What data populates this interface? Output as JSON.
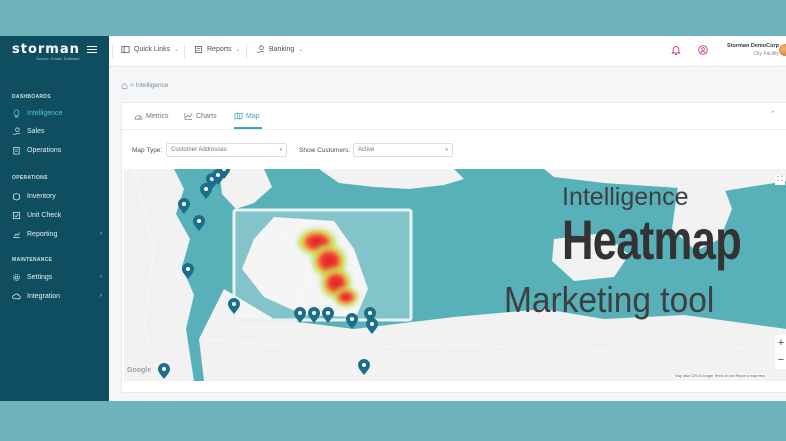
{
  "brand": {
    "logo": "storman",
    "tagline": "Secure. Smart. Software",
    "accent": "#53c3d2",
    "sidebar_bg": "#0f4e61"
  },
  "sidebar": {
    "sections": [
      {
        "title": "DASHBOARDS",
        "items": [
          {
            "label": "Intelligence",
            "icon": "lightbulb-icon",
            "active": true,
            "has_submenu": false
          },
          {
            "label": "Sales",
            "icon": "hand-coins-icon",
            "active": false,
            "has_submenu": false
          },
          {
            "label": "Operations",
            "icon": "clipboard-icon",
            "active": false,
            "has_submenu": false
          }
        ]
      },
      {
        "title": "OPERATIONS",
        "items": [
          {
            "label": "Inventory",
            "icon": "box-icon",
            "active": false,
            "has_submenu": false
          },
          {
            "label": "Unit Check",
            "icon": "grid-check-icon",
            "active": false,
            "has_submenu": false
          },
          {
            "label": "Reporting",
            "icon": "chart-icon",
            "active": false,
            "has_submenu": true
          }
        ]
      },
      {
        "title": "MAINTENANCE",
        "items": [
          {
            "label": "Settings",
            "icon": "gear-icon",
            "active": false,
            "has_submenu": true
          },
          {
            "label": "Integration",
            "icon": "cloud-icon",
            "active": false,
            "has_submenu": true
          }
        ]
      }
    ]
  },
  "topbar": {
    "quick_links": "Quick Links",
    "reports": "Reports",
    "banking": "Banking",
    "org_name": "Storman DemoCorp",
    "location": "City Facility"
  },
  "breadcrumb": "> Intelligence",
  "tabs": [
    {
      "label": "Metrics",
      "icon": "gauge-icon",
      "active": false
    },
    {
      "label": "Charts",
      "icon": "line-chart-icon",
      "active": false
    },
    {
      "label": "Map",
      "icon": "map-icon",
      "active": true
    }
  ],
  "filters": {
    "map_type_label": "Map Type:",
    "map_type_value": "Customer Addresses",
    "show_customers_label": "Show Customers:",
    "show_customers_value": "Active"
  },
  "map": {
    "provider": "Google",
    "attribution": "Map data ©2019 Google   Terms of Use   Report a map error",
    "water_color": "#58b1b8",
    "land_color": "#f1f2f1",
    "marker_color": "#1c6f8a",
    "zoom_in": "+",
    "zoom_out": "−",
    "fullscreen": "⛶"
  },
  "overlay": {
    "line1": "Intelligence",
    "line2": "Heatmap",
    "line3": "Marketing tool"
  }
}
